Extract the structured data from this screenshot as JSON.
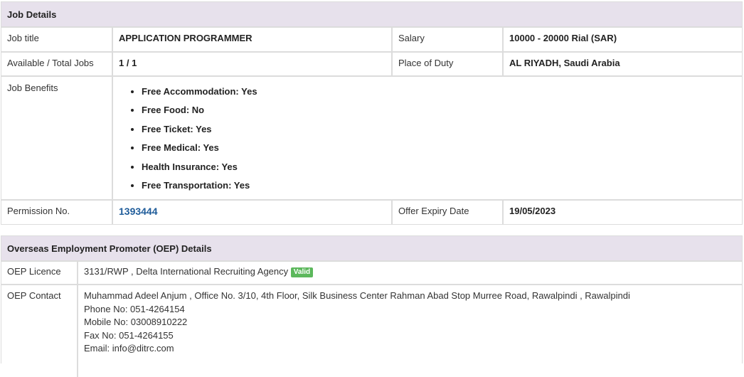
{
  "job": {
    "header": "Job Details",
    "job_title_label": "Job title",
    "job_title": "APPLICATION PROGRAMMER",
    "salary_label": "Salary",
    "salary": "10000 - 20000 Rial (SAR)",
    "available_label": "Available / Total Jobs",
    "available": "1 / 1",
    "place_label": "Place of Duty",
    "place": "AL RIYADH, Saudi Arabia",
    "benefits_label": "Job Benefits",
    "benefits": [
      "Free Accommodation: Yes",
      "Free Food: No",
      "Free Ticket: Yes",
      "Free Medical: Yes",
      "Health Insurance: Yes",
      "Free Transportation: Yes"
    ],
    "permission_label": "Permission No.",
    "permission": "1393444",
    "expiry_label": "Offer Expiry Date",
    "expiry": "19/05/2023"
  },
  "oep": {
    "header": "Overseas Employment Promoter (OEP) Details",
    "licence_label": "OEP Licence",
    "licence": "3131/RWP , Delta International Recruiting Agency",
    "badge": "Valid",
    "contact_label": "OEP Contact",
    "contact_address": "Muhammad Adeel Anjum , Office No. 3/10, 4th Floor, Silk Business Center Rahman Abad Stop Murree Road, Rawalpindi , Rawalpindi",
    "phone": "Phone No: 051-4264154",
    "mobile": "Mobile No: 03008910222",
    "fax": "Fax No: 051-4264155",
    "email": "Email: info@ditrc.com"
  },
  "colors": {
    "header_bg": "#e7e1ec",
    "link": "#1f5c9a",
    "badge": "#5cb85c",
    "border": "#dcdcdc"
  }
}
